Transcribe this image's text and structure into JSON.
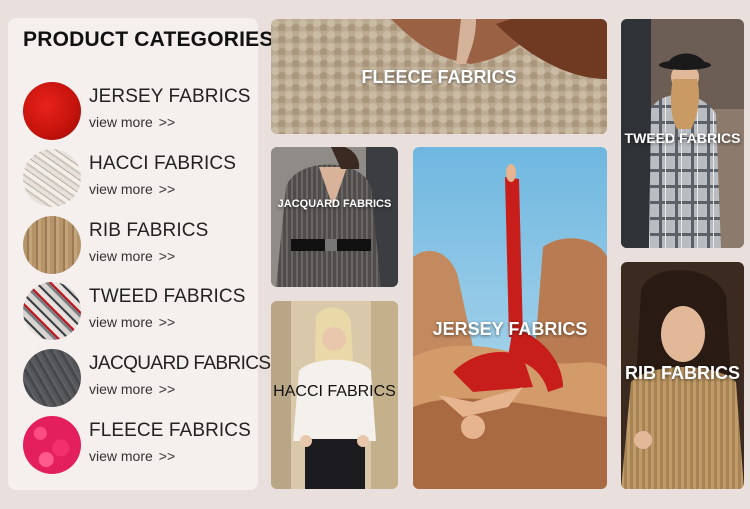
{
  "sidebar": {
    "title": "PRODUCT CATEGORIES",
    "items": [
      {
        "name": "JERSEY FABRICS",
        "link": "view more",
        "arrows": ">>",
        "swatch": "red-jersey-knit"
      },
      {
        "name": "HACCI FABRICS",
        "link": "view more",
        "arrows": ">>",
        "swatch": "cream-hacci-knit"
      },
      {
        "name": "RIB FABRICS",
        "link": "view more",
        "arrows": ">>",
        "swatch": "tan-rib-knit"
      },
      {
        "name": "TWEED FABRICS",
        "link": "view more",
        "arrows": ">>",
        "swatch": "plaid-tweed"
      },
      {
        "name": "JACQUARD FABRICS",
        "link": "view more",
        "arrows": ">>",
        "swatch": "grey-jacquard"
      },
      {
        "name": "FLEECE FABRICS",
        "link": "view more",
        "arrows": ">>",
        "swatch": "pink-fleece"
      }
    ]
  },
  "tiles": {
    "fleece": {
      "label": "FLEECE FABRICS"
    },
    "tweed": {
      "label": "TWEED FABRICS"
    },
    "jacquard": {
      "label": "JACQUARD FABRICS"
    },
    "jersey": {
      "label": "JERSEY FABRICS"
    },
    "hacci": {
      "label": "HACCI FABRICS"
    },
    "rib": {
      "label": "RIB FABRICS"
    }
  },
  "colors": {
    "page_background": "#e9e0de",
    "panel_background": "#f5efed",
    "heading_text": "#111111",
    "label_text": "#ffffff"
  }
}
